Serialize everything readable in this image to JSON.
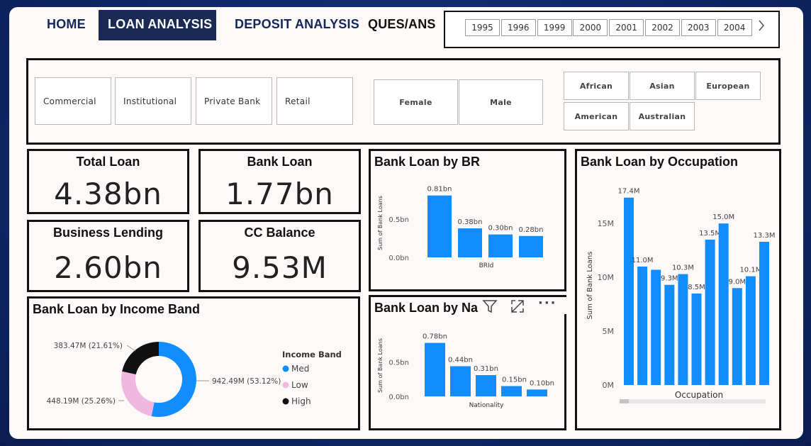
{
  "nav": {
    "home": "HOME",
    "loan": "LOAN ANALYSIS",
    "deposit": "DEPOSIT ANALYSIS",
    "ques": "QUES/ANS"
  },
  "years": [
    "1995",
    "1996",
    "1999",
    "2000",
    "2001",
    "2002",
    "2003",
    "2004"
  ],
  "year_next_icon": "chevron-right-icon",
  "filters": {
    "segments": [
      "Commercial",
      "Institutional",
      "Private Bank",
      "Retail"
    ],
    "genders": [
      "Female",
      "Male"
    ],
    "nationalities": [
      "African",
      "Asian",
      "European",
      "American",
      "Australian"
    ]
  },
  "kpis": [
    {
      "label": "Total Loan",
      "value": "4.38bn"
    },
    {
      "label": "Bank Loan",
      "value": "1.77bn"
    },
    {
      "label": "Business Lending",
      "value": "2.60bn"
    },
    {
      "label": "CC Balance",
      "value": "9.53M"
    }
  ],
  "colors": {
    "bar": "#118dff",
    "med": "#118dff",
    "low": "#f0b8e0",
    "high": "#111111"
  },
  "toolbar_icons": [
    "filter-icon",
    "focus-mode-icon",
    "more-options-icon"
  ],
  "chart_data": [
    {
      "type": "bar",
      "title": "Bank Loan by BR",
      "xlabel": "BRId",
      "ylabel": "Sum of Bank Loans",
      "categories": [],
      "values": [
        0.81,
        0.38,
        0.3,
        0.28
      ],
      "data_labels": [
        "0.81bn",
        "0.38bn",
        "0.30bn",
        "0.28bn"
      ],
      "yticks": [
        "0.0bn",
        "0.5bn"
      ],
      "ylim": [
        0,
        0.9
      ]
    },
    {
      "type": "bar",
      "title": "Bank Loan by Nationality",
      "title_visible": "Bank Loan by Na",
      "xlabel": "Nationality",
      "ylabel": "Sum of Bank Loans",
      "categories": [],
      "values": [
        0.78,
        0.44,
        0.31,
        0.15,
        0.1
      ],
      "data_labels": [
        "0.78bn",
        "0.44bn",
        "0.31bn",
        "0.15bn",
        "0.10bn"
      ],
      "yticks": [
        "0.0bn",
        "0.5bn"
      ],
      "ylim": [
        0,
        0.9
      ]
    },
    {
      "type": "bar",
      "title": "Bank Loan by Occupation",
      "xlabel": "Occupation",
      "ylabel": "Sum of Bank Loans",
      "categories": [],
      "values": [
        17.4,
        11.0,
        10.7,
        9.3,
        10.3,
        8.5,
        13.5,
        15.0,
        9.0,
        10.1,
        13.3
      ],
      "data_labels": [
        "17.4M",
        "11.0M",
        "",
        "9.3M",
        "10.3M",
        "8.5M",
        "13.5M",
        "15.0M",
        "9.0M",
        "10.1M",
        "13.3M"
      ],
      "yticks": [
        "0M",
        "5M",
        "10M",
        "15M"
      ],
      "ylim": [
        0,
        18.5
      ]
    },
    {
      "type": "pie",
      "title": "Bank Loan by Income Band",
      "legend_title": "Income Band",
      "legend_position": "right",
      "slices": [
        {
          "name": "Med",
          "value": 942.49,
          "label": "942.49M (53.12%)",
          "pct": 53.12
        },
        {
          "name": "Low",
          "value": 448.19,
          "label": "448.19M (25.26%)",
          "pct": 25.26
        },
        {
          "name": "High",
          "value": 383.47,
          "label": "383.47M (21.61%)",
          "pct": 21.61
        }
      ]
    }
  ]
}
